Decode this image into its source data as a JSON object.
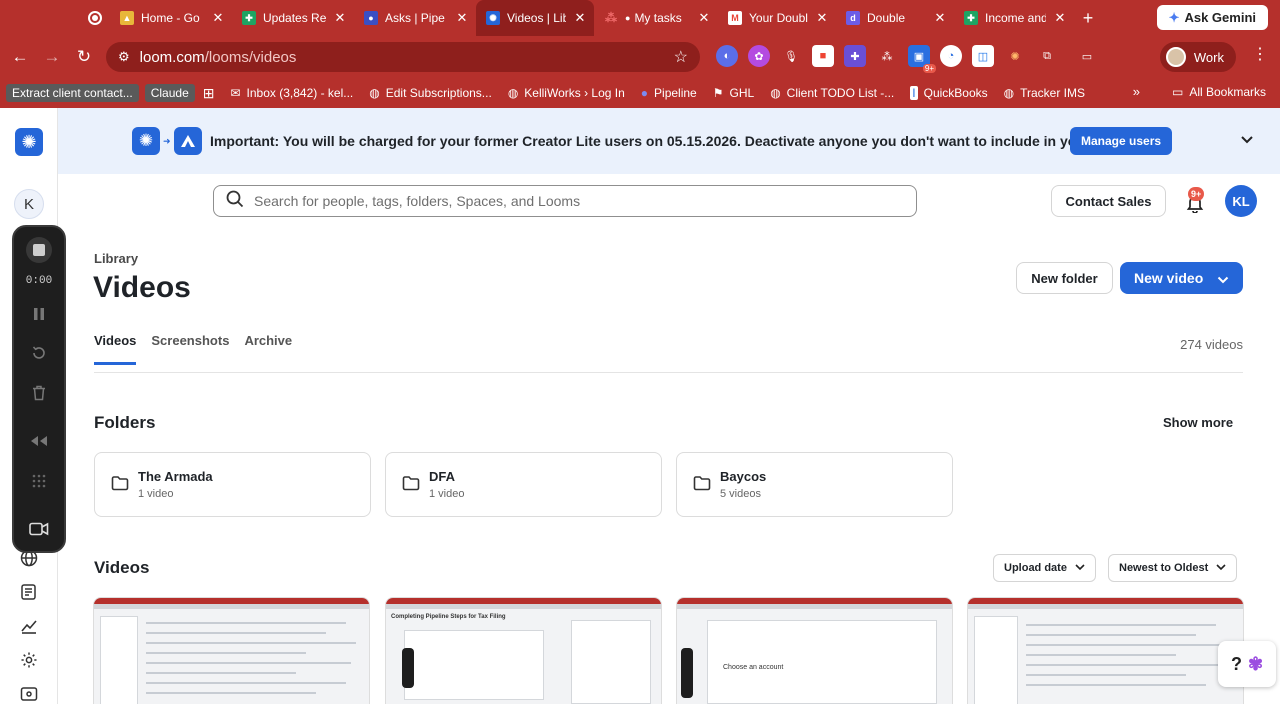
{
  "browser": {
    "tabs": [
      {
        "title": "Home - Go",
        "favicon_color": "#e8b73a",
        "active": false
      },
      {
        "title": "Updates Re",
        "favicon_color": "#1fa463",
        "active": false
      },
      {
        "title": "Asks | Pipe",
        "favicon_color": "#3b4fc4",
        "active": false
      },
      {
        "title": "Videos | Lib",
        "favicon_color": "#2566d8",
        "active": true
      },
      {
        "title": "My tasks",
        "favicon_color": "#f06a6a",
        "active": false
      },
      {
        "title": "Your Doubl",
        "favicon_color": "#ea4335",
        "active": false
      },
      {
        "title": "Double",
        "favicon_color": "#6c5ce7",
        "active": false
      },
      {
        "title": "Income and",
        "favicon_color": "#1fa463",
        "active": false
      }
    ],
    "new_tab": "+",
    "gemini_label": "Ask Gemini",
    "url_host": "loom.com",
    "url_path": "/looms/videos",
    "profile_label": "Work",
    "ext_badge": "9+",
    "bookmarks": [
      {
        "label": "Extract client contact...",
        "style": "pill"
      },
      {
        "label": "Claude",
        "style": "pill"
      },
      {
        "label": "Inbox (3,842) - kel...",
        "icon": "✉"
      },
      {
        "label": "Edit Subscriptions...",
        "icon": "◍"
      },
      {
        "label": "KelliWorks › Log In",
        "icon": "◍"
      },
      {
        "label": "Pipeline",
        "icon": "●"
      },
      {
        "label": "GHL",
        "icon": "⚑"
      },
      {
        "label": "Client TODO List -...",
        "icon": "◍"
      },
      {
        "label": "QuickBooks",
        "icon": "▮"
      },
      {
        "label": "Tracker IMS",
        "icon": "◍"
      }
    ],
    "all_bookmarks": "All Bookmarks"
  },
  "recorder": {
    "time": "0:00"
  },
  "workspace_initial": "K",
  "banner": {
    "text": "Important: You will be charged for your former Creator Lite users on 05.15.2026. Deactivate anyone you don't want to include in your plan.",
    "button": "Manage users"
  },
  "header": {
    "search_placeholder": "Search for people, tags, folders, Spaces, and Looms",
    "contact_sales": "Contact Sales",
    "notif_badge": "9+",
    "avatar_initials": "KL"
  },
  "library": {
    "label": "Library",
    "title": "Videos",
    "new_folder": "New folder",
    "new_video": "New video",
    "tabs": [
      "Videos",
      "Screenshots",
      "Archive"
    ],
    "count": "274 videos"
  },
  "folders": {
    "title": "Folders",
    "show_more": "Show more",
    "items": [
      {
        "name": "The Armada",
        "count": "1 video"
      },
      {
        "name": "DFA",
        "count": "1 video"
      },
      {
        "name": "Baycos",
        "count": "5 videos"
      }
    ]
  },
  "videos": {
    "title": "Videos",
    "sort_field": "Upload date",
    "sort_order": "Newest to Oldest",
    "thumbs": [
      {
        "caption": ""
      },
      {
        "caption": "Completing Pipeline Steps for Tax Filing"
      },
      {
        "caption": "Choose an account"
      },
      {
        "caption": ""
      }
    ]
  },
  "help_label": "?",
  "colors": {
    "brand_blue": "#2566d8",
    "chrome_red": "#b5302c",
    "banner_bg": "#eaf1fc"
  }
}
